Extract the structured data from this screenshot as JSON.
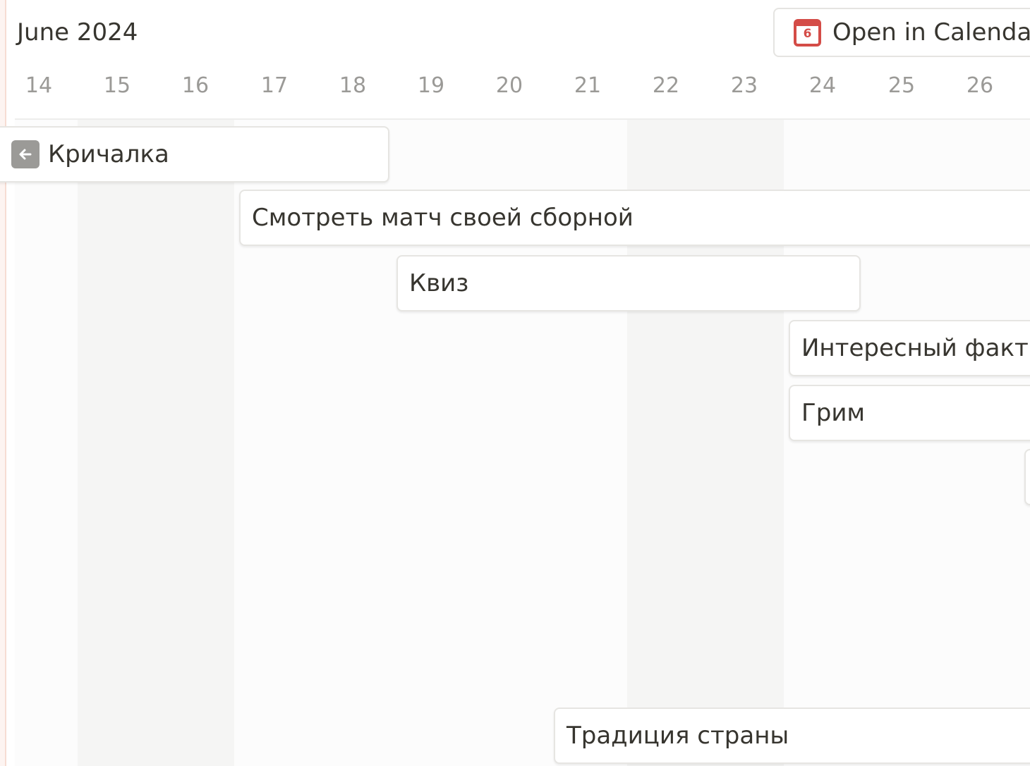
{
  "header": {
    "month_title": "June 2024",
    "open_calendar_label": "Open in Calendar",
    "calendar_icon_day": "6"
  },
  "days": [
    "14",
    "15",
    "16",
    "17",
    "18",
    "19",
    "20",
    "21",
    "22",
    "23",
    "24",
    "25",
    "26"
  ],
  "events": [
    {
      "title": "Кричалка",
      "has_back_icon": true
    },
    {
      "title": "Смотреть матч своей сборной"
    },
    {
      "title": "Квиз"
    },
    {
      "title": "Интересный факт"
    },
    {
      "title": "Грим"
    },
    {
      "title": ""
    },
    {
      "title": "Традиция страны"
    }
  ],
  "colors": {
    "accent_red": "#d44c47",
    "text": "#37352f",
    "muted_text": "#9b9a97",
    "weekend_bg": "#f5f5f4"
  }
}
